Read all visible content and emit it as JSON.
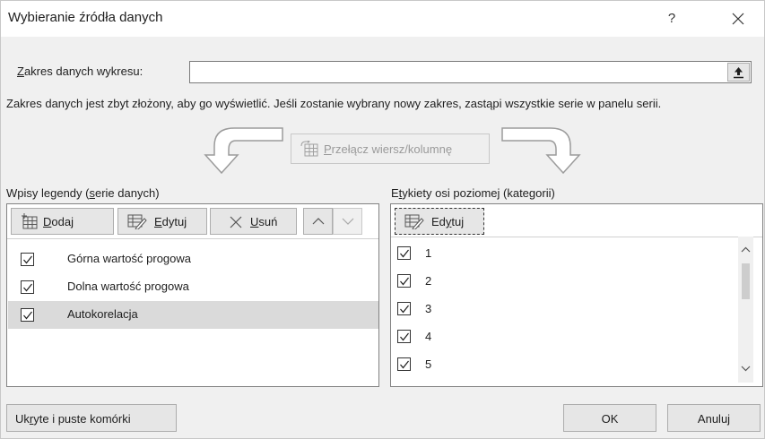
{
  "dialog": {
    "title": "Wybieranie źródła danych",
    "help_label": "?",
    "range": {
      "label_prefix": "",
      "label_underlined": "Z",
      "label_rest": "akres danych wykresu:",
      "value": ""
    },
    "warning": "Zakres danych jest zbyt złożony, aby go wyświetlić. Jeśli zostanie wybrany nowy zakres, zastąpi wszystkie serie w panelu serii.",
    "switch_button": {
      "prefix": "",
      "underlined": "P",
      "rest": "rzełącz wiersz/kolumnę"
    },
    "legend": {
      "header_prefix": "Wpisy legendy (",
      "header_underlined": "s",
      "header_rest": "erie danych)",
      "add": {
        "underlined": "D",
        "rest": "odaj"
      },
      "edit": {
        "underlined": "E",
        "rest": "dytuj"
      },
      "remove": {
        "underlined": "U",
        "rest": "suń"
      },
      "items": [
        {
          "label": "Górna wartość progowa",
          "checked": true,
          "selected": false
        },
        {
          "label": "Dolna wartość progowa",
          "checked": true,
          "selected": false
        },
        {
          "label": "Autokorelacja",
          "checked": true,
          "selected": true
        }
      ]
    },
    "axis": {
      "header_prefix": "E",
      "header_underlined": "t",
      "header_rest": "ykiety osi poziomej (kategorii)",
      "edit": {
        "prefix": "Ed",
        "underlined": "y",
        "rest": "tuj"
      },
      "items": [
        {
          "label": "1",
          "checked": true
        },
        {
          "label": "2",
          "checked": true
        },
        {
          "label": "3",
          "checked": true
        },
        {
          "label": "4",
          "checked": true
        },
        {
          "label": "5",
          "checked": true
        }
      ]
    },
    "hidden_cells_button": {
      "prefix": "Uk",
      "underlined": "r",
      "rest": "yte i puste komórki"
    },
    "ok_label": "OK",
    "cancel_label": "Anuluj"
  },
  "colors": {
    "dialog_bg": "#f0f0f0",
    "button_bg": "#e6e6e6",
    "selected_row": "#dadada",
    "disabled_text": "#9a9a9a"
  },
  "icons": [
    "help-icon",
    "close-icon",
    "collapse-range-icon",
    "switch-row-column-icon",
    "add-icon",
    "edit-icon",
    "remove-icon",
    "move-up-icon",
    "move-down-icon",
    "checkbox-icon",
    "scroll-up-icon",
    "scroll-down-icon",
    "curved-arrow-left-icon",
    "curved-arrow-right-icon"
  ]
}
